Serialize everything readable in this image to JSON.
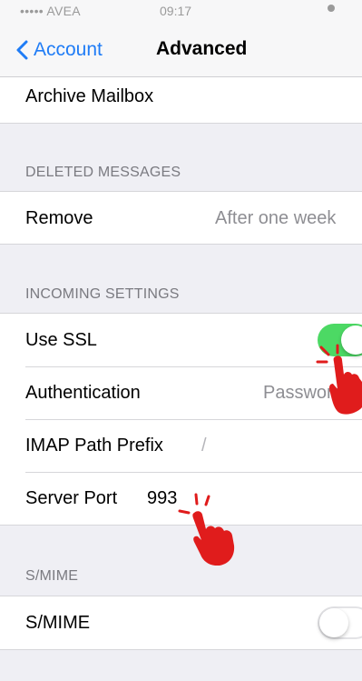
{
  "status_bar": {
    "carrier": "••••• AVEA",
    "time": "09:17"
  },
  "nav": {
    "back_label": "Account",
    "title": "Advanced"
  },
  "rows": {
    "archive_mailbox": "Archive Mailbox",
    "remove": {
      "label": "Remove",
      "value": "After one week"
    },
    "use_ssl": {
      "label": "Use SSL",
      "on": true
    },
    "authentication": {
      "label": "Authentication",
      "value": "Password"
    },
    "imap_path_prefix": {
      "label": "IMAP Path Prefix",
      "value": "/"
    },
    "server_port": {
      "label": "Server Port",
      "value": "993"
    },
    "smime": {
      "label": "S/MIME",
      "on": false
    }
  },
  "sections": {
    "deleted_messages": "DELETED MESSAGES",
    "incoming_settings": "INCOMING SETTINGS",
    "smime": "S/MIME"
  },
  "colors": {
    "accent": "#1f7cf6",
    "toggle_on": "#4cd964",
    "pointer_hand": "#e01c1c"
  }
}
